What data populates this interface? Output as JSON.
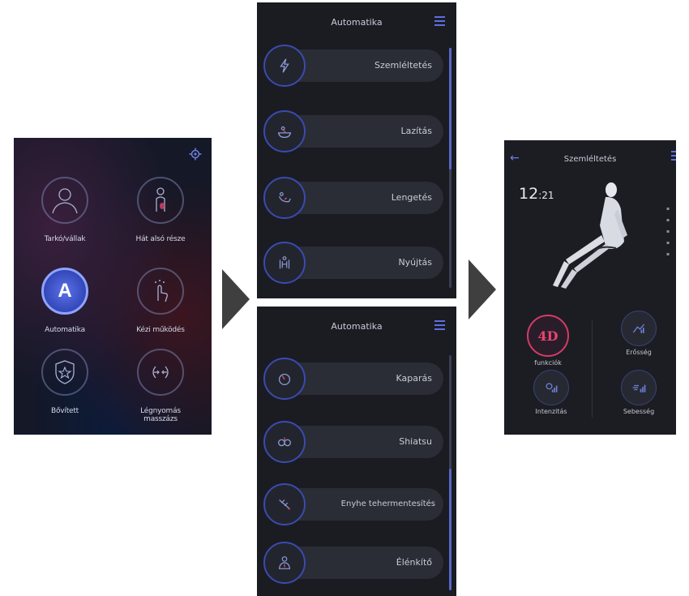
{
  "home": {
    "tiles": [
      {
        "label": "Tarkó/vállak",
        "icon": "head-shoulders-icon"
      },
      {
        "label": "Hát alsó része",
        "icon": "lower-back-icon"
      },
      {
        "label": "Automatika",
        "icon": "auto-a-icon",
        "glyph": "A"
      },
      {
        "label": "Kézi működés",
        "icon": "hand-touch-icon"
      },
      {
        "label": "Bővített",
        "icon": "shield-star-icon"
      },
      {
        "label": "Légnyomás masszázs",
        "icon": "air-pressure-icon"
      }
    ]
  },
  "list_top": {
    "title": "Automatika",
    "items": [
      {
        "label": "Szemléltetés",
        "icon": "lightning-icon"
      },
      {
        "label": "Lazítás",
        "icon": "relax-bath-icon"
      },
      {
        "label": "Lengetés",
        "icon": "swing-icon"
      },
      {
        "label": "Nyújtás",
        "icon": "stretch-icon"
      }
    ]
  },
  "list_bottom": {
    "title": "Automatika",
    "items": [
      {
        "label": "Kaparás",
        "icon": "scrape-icon"
      },
      {
        "label": "Shiatsu",
        "icon": "shiatsu-icon"
      },
      {
        "label": "Enyhe tehermentesítés",
        "icon": "relief-icon"
      },
      {
        "label": "Élénkítő",
        "icon": "vitalize-icon"
      }
    ]
  },
  "detail": {
    "title": "Szemléltetés",
    "time_hours": "12",
    "time_minutes": ":21",
    "fourd_badge": "4D",
    "buttons": [
      {
        "label": "funkciók",
        "icon": "4d-icon"
      },
      {
        "label": "Erősség",
        "icon": "strength-icon"
      },
      {
        "label": "Intenzitás",
        "icon": "intensity-icon"
      },
      {
        "label": "Sebesség",
        "icon": "speed-icon"
      }
    ]
  },
  "colors": {
    "accent": "#5c6fe0",
    "fourd": "#e9446f",
    "panel": "#1a1c22",
    "pill": "#2a2d35",
    "arrow": "#3f3f3f"
  }
}
